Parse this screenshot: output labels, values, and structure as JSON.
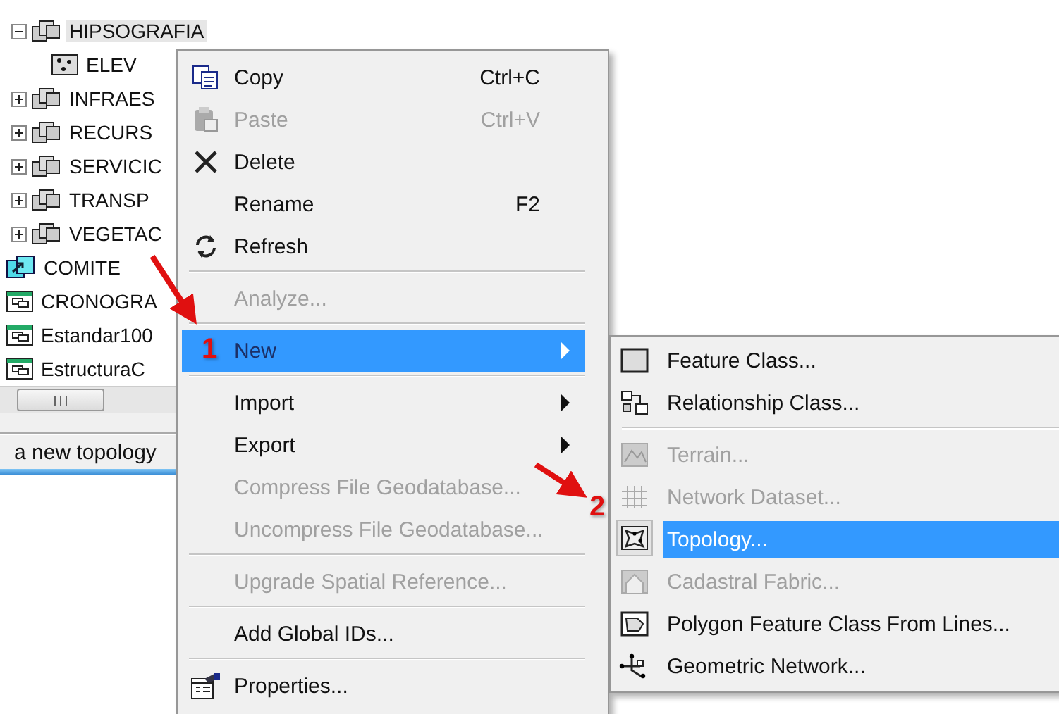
{
  "tree": [
    {
      "label": "HIPSOGRAFIA",
      "kind": "dataset",
      "expanded": true,
      "selected": true,
      "children": [
        {
          "label": "ELEV",
          "kind": "featureclass",
          "selected": false
        }
      ]
    },
    {
      "label": "INFRAES",
      "kind": "dataset",
      "expanded": false,
      "selected": false
    },
    {
      "label": "RECURS",
      "kind": "dataset",
      "expanded": false,
      "selected": false
    },
    {
      "label": "SERVICIC",
      "kind": "dataset",
      "expanded": false,
      "selected": false
    },
    {
      "label": "TRANSP",
      "kind": "dataset",
      "expanded": false,
      "selected": false
    },
    {
      "label": "VEGETAC",
      "kind": "dataset",
      "expanded": false,
      "selected": false
    },
    {
      "label": "COMITE",
      "kind": "relationship",
      "selected": false
    },
    {
      "label": "CRONOGRA",
      "kind": "table",
      "selected": false
    },
    {
      "label": "Estandar100",
      "kind": "table",
      "selected": false
    },
    {
      "label": "EstructuraC",
      "kind": "table",
      "selected": false
    }
  ],
  "status_bar": {
    "text": "a new topology"
  },
  "context_menu": {
    "items": [
      {
        "kind": "item",
        "label": "Copy",
        "shortcut": "Ctrl+C",
        "disabled": false,
        "selected": false,
        "has_submenu": false
      },
      {
        "kind": "item",
        "label": "Paste",
        "shortcut": "Ctrl+V",
        "disabled": true,
        "selected": false,
        "has_submenu": false
      },
      {
        "kind": "item",
        "label": "Delete",
        "disabled": false,
        "selected": false,
        "has_submenu": false
      },
      {
        "kind": "item",
        "label": "Rename",
        "shortcut": "F2",
        "disabled": false,
        "selected": false,
        "has_submenu": false
      },
      {
        "kind": "item",
        "label": "Refresh",
        "disabled": false,
        "selected": false,
        "has_submenu": false
      },
      {
        "kind": "separator"
      },
      {
        "kind": "item",
        "label": "Analyze...",
        "disabled": true,
        "selected": false,
        "has_submenu": false
      },
      {
        "kind": "separator"
      },
      {
        "kind": "item",
        "label": "New",
        "disabled": false,
        "selected": true,
        "has_submenu": true
      },
      {
        "kind": "separator"
      },
      {
        "kind": "item",
        "label": "Import",
        "disabled": false,
        "selected": false,
        "has_submenu": true
      },
      {
        "kind": "item",
        "label": "Export",
        "disabled": false,
        "selected": false,
        "has_submenu": true
      },
      {
        "kind": "item",
        "label": "Compress File Geodatabase...",
        "disabled": true,
        "selected": false,
        "has_submenu": false
      },
      {
        "kind": "item",
        "label": "Uncompress File Geodatabase...",
        "disabled": true,
        "selected": false,
        "has_submenu": false
      },
      {
        "kind": "separator"
      },
      {
        "kind": "item",
        "label": "Upgrade Spatial Reference...",
        "disabled": true,
        "selected": false,
        "has_submenu": false
      },
      {
        "kind": "separator"
      },
      {
        "kind": "item",
        "label": "Add Global IDs...",
        "disabled": false,
        "selected": false,
        "has_submenu": false
      },
      {
        "kind": "separator"
      },
      {
        "kind": "item",
        "label": "Properties...",
        "disabled": false,
        "selected": false,
        "has_submenu": false
      }
    ]
  },
  "submenu": {
    "items": [
      {
        "kind": "item",
        "label": "Feature Class...",
        "disabled": false,
        "selected": false
      },
      {
        "kind": "item",
        "label": "Relationship Class...",
        "disabled": false,
        "selected": false
      },
      {
        "kind": "separator"
      },
      {
        "kind": "item",
        "label": "Terrain...",
        "disabled": true,
        "selected": false
      },
      {
        "kind": "item",
        "label": "Network Dataset...",
        "disabled": true,
        "selected": false
      },
      {
        "kind": "item",
        "label": "Topology...",
        "disabled": false,
        "selected": true
      },
      {
        "kind": "item",
        "label": "Cadastral Fabric...",
        "disabled": true,
        "selected": false
      },
      {
        "kind": "item",
        "label": "Polygon Feature Class From Lines...",
        "disabled": false,
        "selected": false
      },
      {
        "kind": "item",
        "label": "Geometric Network...",
        "disabled": false,
        "selected": false
      }
    ]
  },
  "annotations": [
    {
      "label": "1"
    },
    {
      "label": "2"
    }
  ]
}
